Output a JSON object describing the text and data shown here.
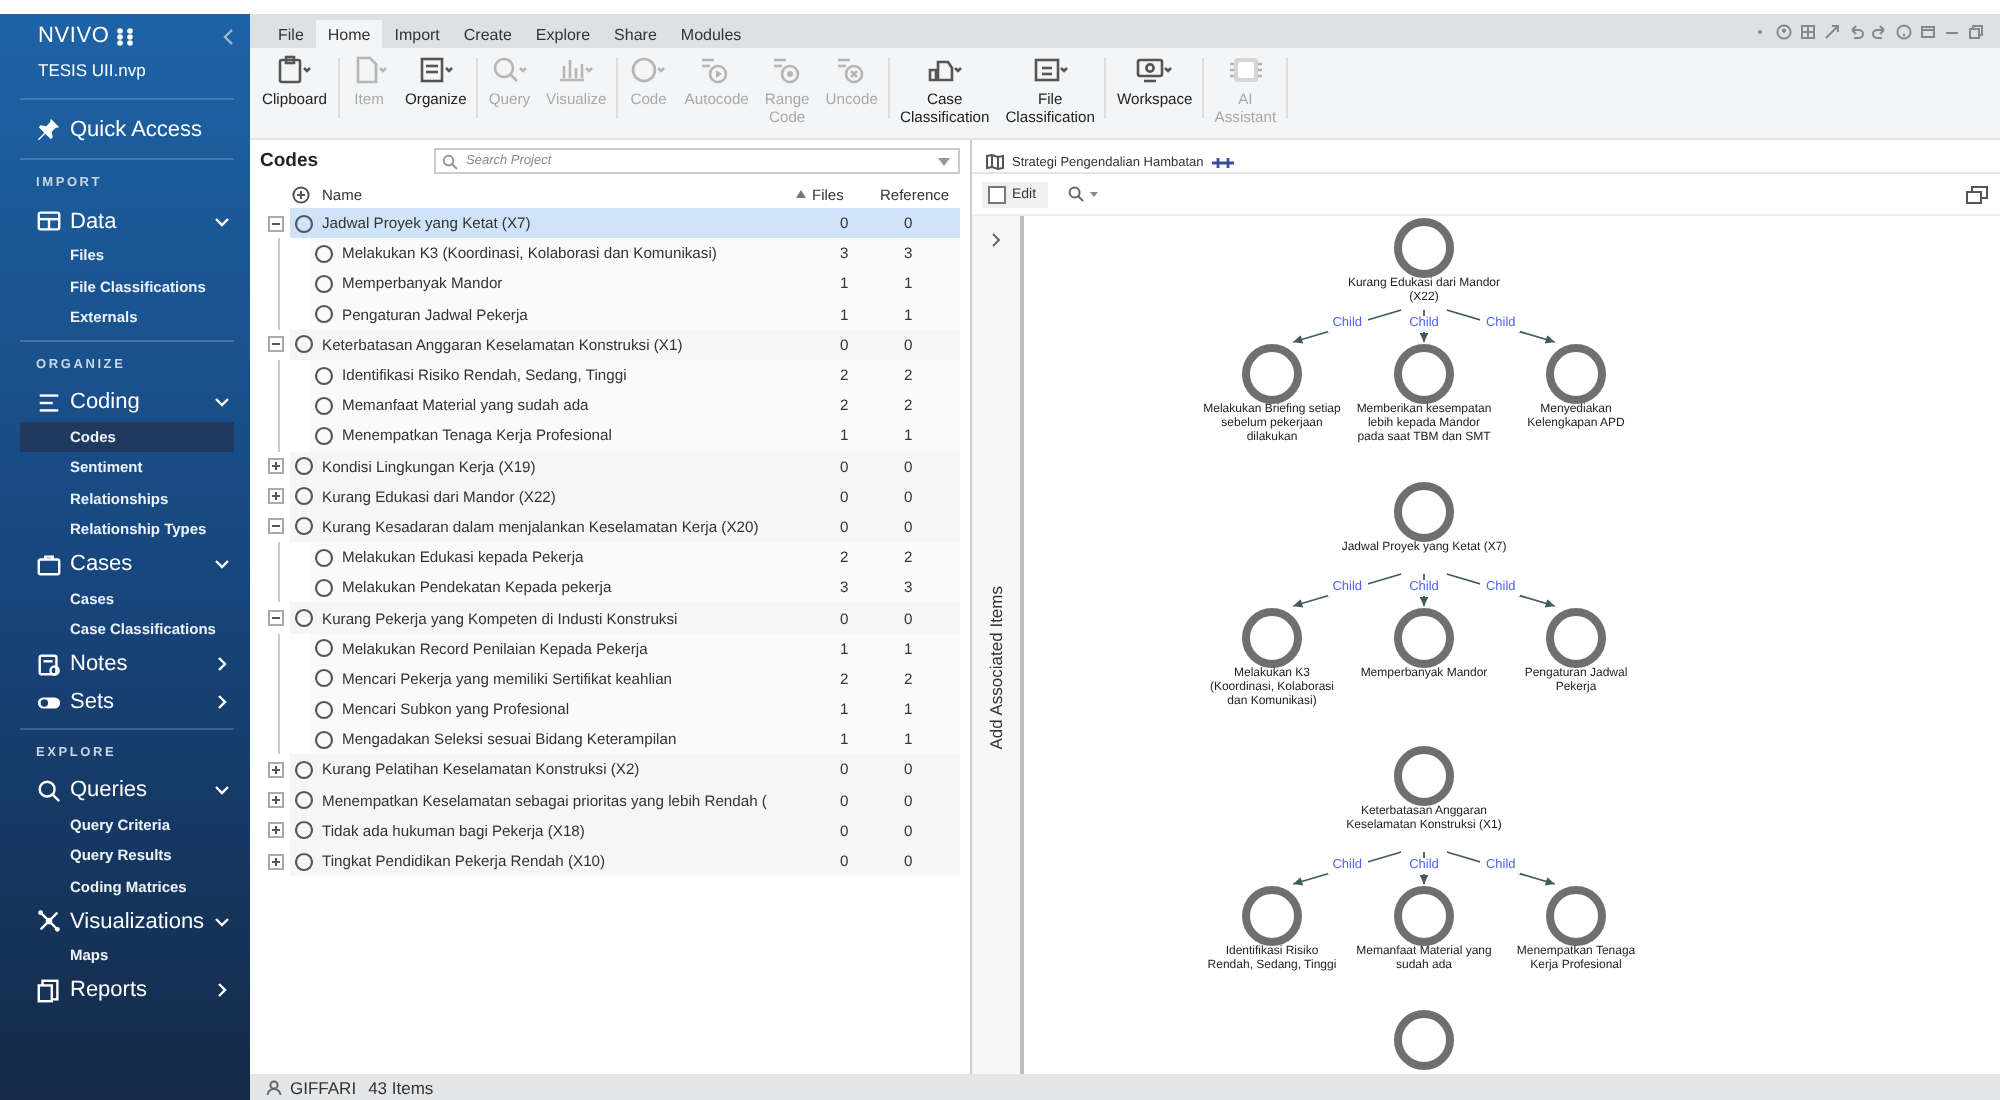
{
  "sidebar": {
    "app_name": "NVIVO",
    "project": "TESIS UII.nvp",
    "quick_access": "Quick Access",
    "sections": [
      {
        "heading": "IMPORT",
        "groups": [
          {
            "label": "Data",
            "expanded": true,
            "items": [
              {
                "label": "Files",
                "selected": false
              },
              {
                "label": "File Classifications",
                "selected": false
              },
              {
                "label": "Externals",
                "selected": false
              }
            ]
          }
        ]
      },
      {
        "heading": "ORGANIZE",
        "groups": [
          {
            "label": "Coding",
            "expanded": true,
            "items": [
              {
                "label": "Codes",
                "selected": true
              },
              {
                "label": "Sentiment",
                "selected": false
              },
              {
                "label": "Relationships",
                "selected": false
              },
              {
                "label": "Relationship Types",
                "selected": false
              }
            ]
          },
          {
            "label": "Cases",
            "expanded": true,
            "items": [
              {
                "label": "Cases",
                "selected": false
              },
              {
                "label": "Case Classifications",
                "selected": false
              }
            ]
          },
          {
            "label": "Notes",
            "expanded": false
          },
          {
            "label": "Sets",
            "expanded": false
          }
        ]
      },
      {
        "heading": "EXPLORE",
        "groups": [
          {
            "label": "Queries",
            "expanded": true,
            "items": [
              {
                "label": "Query Criteria",
                "selected": false
              },
              {
                "label": "Query Results",
                "selected": false
              },
              {
                "label": "Coding Matrices",
                "selected": false
              }
            ]
          },
          {
            "label": "Visualizations",
            "expanded": true,
            "items": [
              {
                "label": "Maps",
                "selected": false
              }
            ]
          },
          {
            "label": "Reports",
            "expanded": false
          }
        ]
      }
    ]
  },
  "menu_tabs": [
    {
      "label": "File",
      "selected": false
    },
    {
      "label": "Home",
      "selected": true
    },
    {
      "label": "Import",
      "selected": false
    },
    {
      "label": "Create",
      "selected": false
    },
    {
      "label": "Explore",
      "selected": false
    },
    {
      "label": "Share",
      "selected": false
    },
    {
      "label": "Modules",
      "selected": false
    }
  ],
  "ribbon": {
    "groups": [
      [
        {
          "label": "Clipboard",
          "disabled": false
        }
      ],
      [
        {
          "label": "Item",
          "disabled": true
        },
        {
          "label": "Organize",
          "disabled": false
        }
      ],
      [
        {
          "label": "Query",
          "disabled": true
        },
        {
          "label": "Visualize",
          "disabled": true
        }
      ],
      [
        {
          "label": "Code",
          "disabled": true
        },
        {
          "label": "Autocode",
          "disabled": true
        },
        {
          "label": "Range Code",
          "disabled": true
        },
        {
          "label": "Uncode",
          "disabled": true
        }
      ],
      [
        {
          "label": "Case Classification",
          "disabled": false
        },
        {
          "label": "File Classification",
          "disabled": false
        }
      ],
      [
        {
          "label": "Workspace",
          "disabled": false
        }
      ],
      [
        {
          "label": "AI Assistant",
          "disabled": true
        }
      ]
    ]
  },
  "codes_panel": {
    "title": "Codes",
    "search": {
      "placeholder": "Search Project"
    },
    "columns": [
      "Name",
      "Files",
      "Reference"
    ],
    "rows": [
      {
        "name": "Jadwal Proyek yang Ketat (X7)",
        "files": "0",
        "references": "0",
        "expanded": true,
        "selected": true,
        "children": [
          {
            "name": "Melakukan K3 (Koordinasi, Kolaborasi dan Komunikasi)",
            "files": "3",
            "references": "3",
            "selected": false
          },
          {
            "name": "Memperbanyak Mandor",
            "files": "1",
            "references": "1",
            "selected": false
          },
          {
            "name": "Pengaturan Jadwal Pekerja",
            "files": "1",
            "references": "1",
            "selected": false
          }
        ]
      },
      {
        "name": "Keterbatasan Anggaran Keselamatan Konstruksi (X1)",
        "files": "0",
        "references": "0",
        "expanded": true,
        "selected": false,
        "children": [
          {
            "name": "Identifikasi Risiko Rendah, Sedang, Tinggi",
            "files": "2",
            "references": "2",
            "selected": false
          },
          {
            "name": "Memanfaat Material yang sudah ada",
            "files": "2",
            "references": "2",
            "selected": false
          },
          {
            "name": "Menempatkan Tenaga Kerja Profesional",
            "files": "1",
            "references": "1",
            "selected": false
          }
        ]
      },
      {
        "name": "Kondisi Lingkungan Kerja (X19)",
        "files": "0",
        "references": "0",
        "expanded": false,
        "selected": false
      },
      {
        "name": "Kurang Edukasi dari Mandor (X22)",
        "files": "0",
        "references": "0",
        "expanded": false,
        "selected": false
      },
      {
        "name": "Kurang Kesadaran dalam menjalankan Keselamatan Kerja (X20)",
        "files": "0",
        "references": "0",
        "expanded": true,
        "selected": false,
        "children": [
          {
            "name": "Melakukan Edukasi kepada Pekerja",
            "files": "2",
            "references": "2",
            "selected": false
          },
          {
            "name": "Melakukan Pendekatan Kepada pekerja",
            "files": "3",
            "references": "3",
            "selected": false
          }
        ]
      },
      {
        "name": "Kurang Pekerja yang Kompeten di Industi Konstruksi",
        "files": "0",
        "references": "0",
        "expanded": true,
        "selected": false,
        "children": [
          {
            "name": "Melakukan Record Penilaian Kepada Pekerja",
            "files": "1",
            "references": "1",
            "selected": false
          },
          {
            "name": "Mencari Pekerja yang memiliki Sertifikat keahlian",
            "files": "2",
            "references": "2",
            "selected": false
          },
          {
            "name": "Mencari Subkon yang Profesional",
            "files": "1",
            "references": "1",
            "selected": false
          },
          {
            "name": "Mengadakan Seleksi sesuai Bidang Keterampilan",
            "files": "1",
            "references": "1",
            "selected": false
          }
        ]
      },
      {
        "name": "Kurang Pelatihan Keselamatan Konstruksi (X2)",
        "files": "0",
        "references": "0",
        "expanded": false,
        "selected": false
      },
      {
        "name": "Menempatkan Keselamatan sebagai prioritas yang lebih Rendah (",
        "files": "0",
        "references": "0",
        "expanded": false,
        "selected": false
      },
      {
        "name": "Tidak ada hukuman bagi Pekerja (X18)",
        "files": "0",
        "references": "0",
        "expanded": false,
        "selected": false
      },
      {
        "name": "Tingkat Pendidikan Pekerja Rendah (X10)",
        "files": "0",
        "references": "0",
        "expanded": false,
        "selected": false
      }
    ]
  },
  "map": {
    "tab": "Strategi Pengendalian Hambatan",
    "edit": {
      "label": "Edit",
      "checked": false
    },
    "side_label": "Add Associated Items",
    "groups": [
      {
        "parent": "Kurang Edukasi dari Mandor (X22)",
        "children": [
          {
            "label": "Melakukan Briefing setiap sebelum pekerjaan dilakukan",
            "edge": "Child"
          },
          {
            "label": "Memberikan kesempatan lebih kepada Mandor pada saat TBM dan SMT",
            "edge": "Child"
          },
          {
            "label": "Menyediakan Kelengkapan APD",
            "edge": "Child"
          }
        ]
      },
      {
        "parent": "Jadwal Proyek yang Ketat (X7)",
        "children": [
          {
            "label": "Melakukan K3 (Koordinasi, Kolaborasi dan Komunikasi)",
            "edge": "Child"
          },
          {
            "label": "Memperbanyak Mandor",
            "edge": "Child"
          },
          {
            "label": "Pengaturan Jadwal Pekerja",
            "edge": "Child"
          }
        ]
      },
      {
        "parent": "Keterbatasan Anggaran Keselamatan Konstruksi (X1)",
        "children": [
          {
            "label": "Identifikasi Risiko Rendah, Sedang, Tinggi",
            "edge": "Child"
          },
          {
            "label": "Memanfaat Material yang sudah ada",
            "edge": "Child"
          },
          {
            "label": "Menempatkan Tenaga Kerja Profesional",
            "edge": "Child"
          }
        ]
      }
    ],
    "trailing_node": true
  },
  "status_bar": {
    "user": "GIFFARI",
    "count": "43 Items"
  }
}
